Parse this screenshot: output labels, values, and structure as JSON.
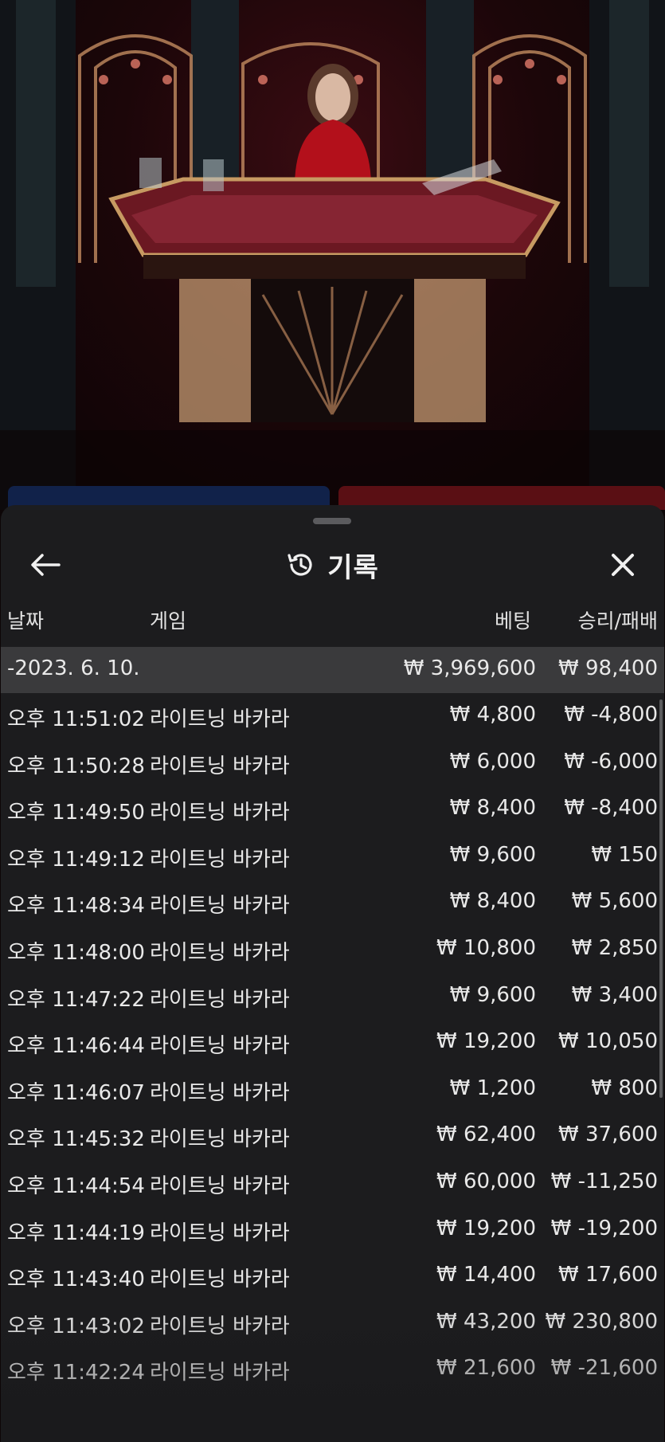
{
  "header": {
    "title": "기록",
    "back_icon": "arrow-left-icon",
    "history_icon": "history-icon",
    "close_icon": "close-icon"
  },
  "columns": {
    "date": "날짜",
    "game": "게임",
    "bet": "베팅",
    "result": "승리/패배"
  },
  "day_summary": {
    "date": "-2023. 6. 10.",
    "bet": "₩ 3,969,600",
    "result": "₩ 98,400"
  },
  "rows": [
    {
      "time": "오후 11:51:02",
      "game": "라이트닝 바카라",
      "bet": "₩ 4,800",
      "result": "₩ -4,800"
    },
    {
      "time": "오후 11:50:28",
      "game": "라이트닝 바카라",
      "bet": "₩ 6,000",
      "result": "₩ -6,000"
    },
    {
      "time": "오후 11:49:50",
      "game": "라이트닝 바카라",
      "bet": "₩ 8,400",
      "result": "₩ -8,400"
    },
    {
      "time": "오후 11:49:12",
      "game": "라이트닝 바카라",
      "bet": "₩ 9,600",
      "result": "₩ 150"
    },
    {
      "time": "오후 11:48:34",
      "game": "라이트닝 바카라",
      "bet": "₩ 8,400",
      "result": "₩ 5,600"
    },
    {
      "time": "오후 11:48:00",
      "game": "라이트닝 바카라",
      "bet": "₩ 10,800",
      "result": "₩ 2,850"
    },
    {
      "time": "오후 11:47:22",
      "game": "라이트닝 바카라",
      "bet": "₩ 9,600",
      "result": "₩ 3,400"
    },
    {
      "time": "오후 11:46:44",
      "game": "라이트닝 바카라",
      "bet": "₩ 19,200",
      "result": "₩ 10,050"
    },
    {
      "time": "오후 11:46:07",
      "game": "라이트닝 바카라",
      "bet": "₩ 1,200",
      "result": "₩ 800"
    },
    {
      "time": "오후 11:45:32",
      "game": "라이트닝 바카라",
      "bet": "₩ 62,400",
      "result": "₩ 37,600"
    },
    {
      "time": "오후 11:44:54",
      "game": "라이트닝 바카라",
      "bet": "₩ 60,000",
      "result": "₩ -11,250"
    },
    {
      "time": "오후 11:44:19",
      "game": "라이트닝 바카라",
      "bet": "₩ 19,200",
      "result": "₩ -19,200"
    },
    {
      "time": "오후 11:43:40",
      "game": "라이트닝 바카라",
      "bet": "₩ 14,400",
      "result": "₩ 17,600"
    },
    {
      "time": "오후 11:43:02",
      "game": "라이트닝 바카라",
      "bet": "₩ 43,200",
      "result": "₩ 230,800"
    },
    {
      "time": "오후 11:42:24",
      "game": "라이트닝 바카라",
      "bet": "₩ 21,600",
      "result": "₩ -21,600"
    }
  ]
}
